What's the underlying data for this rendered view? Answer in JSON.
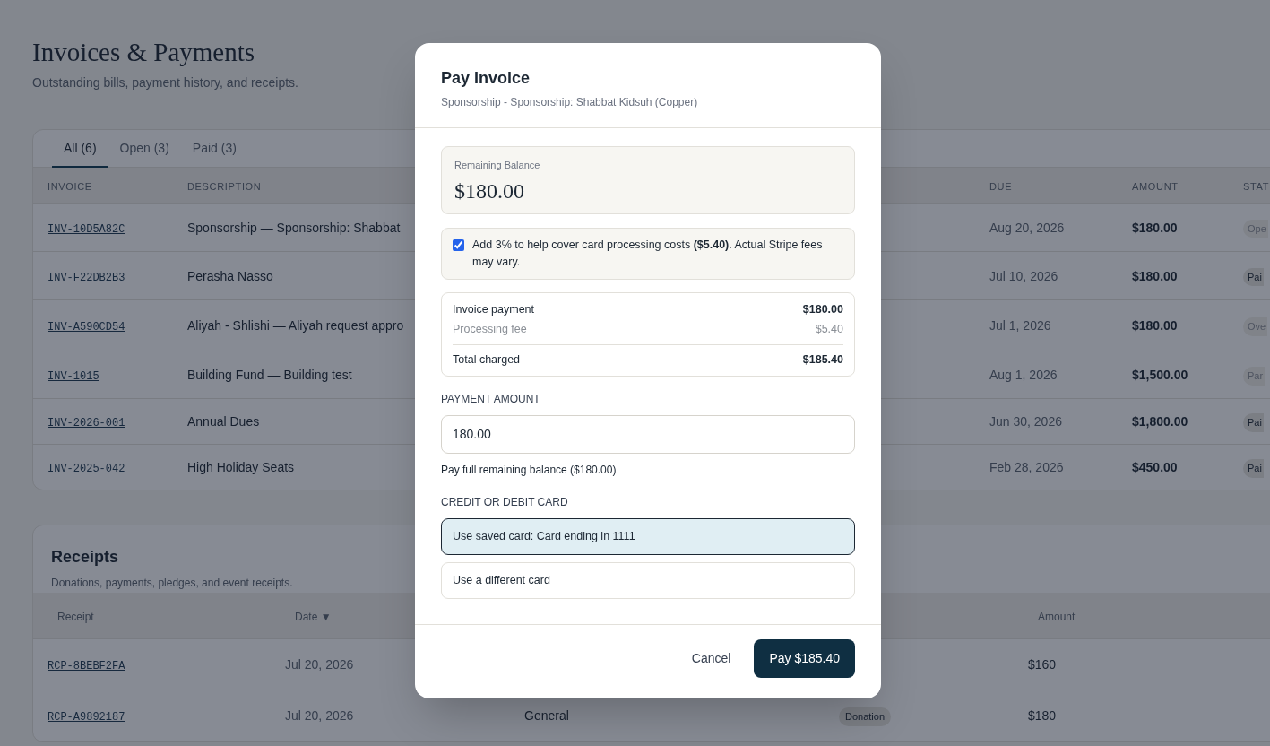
{
  "page": {
    "title": "Invoices & Payments",
    "subtitle": "Outstanding bills, payment history, and receipts."
  },
  "invoices": {
    "tabs": [
      {
        "label": "All (6)",
        "selected": true
      },
      {
        "label": "Open (3)",
        "selected": false
      },
      {
        "label": "Paid (3)",
        "selected": false
      }
    ],
    "columns": [
      "INVOICE",
      "DESCRIPTION",
      "DUE",
      "AMOUNT",
      "STAT"
    ],
    "rows": [
      {
        "invoice": "INV-10D5A82C",
        "description": "Sponsorship — Sponsorship: Shabbat",
        "due": "Aug 20, 2026",
        "amount": "$180.00",
        "status": {
          "label": "Ope",
          "kind": "faded"
        }
      },
      {
        "invoice": "INV-F22DB2B3",
        "description": "Perasha Nasso",
        "due": "Jul 10, 2026",
        "amount": "$180.00",
        "status": {
          "label": "Pai",
          "kind": "paid"
        }
      },
      {
        "invoice": "INV-A590CD54",
        "description": "Aliyah - Shlishi — Aliyah request appro",
        "due": "Jul 1, 2026",
        "amount": "$180.00",
        "status": {
          "label": "Ove",
          "kind": "faded"
        }
      },
      {
        "invoice": "INV-1015",
        "description": "Building Fund — Building test",
        "due": "Aug 1, 2026",
        "amount": "$1,500.00",
        "status": {
          "label": "Par",
          "kind": "faded"
        }
      },
      {
        "invoice": "INV-2026-001",
        "description": "Annual Dues",
        "due": "Jun 30, 2026",
        "amount": "$1,800.00",
        "status": {
          "label": "Pai",
          "kind": "paid"
        }
      },
      {
        "invoice": "INV-2025-042",
        "description": "High Holiday Seats",
        "due": "Feb 28, 2026",
        "amount": "$450.00",
        "status": {
          "label": "Pai",
          "kind": "paid"
        }
      }
    ]
  },
  "receipts": {
    "title": "Receipts",
    "subtitle": "Donations, payments, pledges, and event receipts.",
    "columns": [
      "Receipt",
      "Date ▼",
      null,
      null,
      "Amount"
    ],
    "rows": [
      {
        "receipt": "RCP-8BEBF2FA",
        "date": "Jul 20, 2026",
        "amount": "$160"
      },
      {
        "receipt": "RCP-A9892187",
        "date": "Jul 20, 2026",
        "category": "General",
        "type": "Donation",
        "amount": "$180"
      }
    ]
  },
  "modal": {
    "title": "Pay Invoice",
    "subtitle": "Sponsorship - Sponsorship: Shabbat Kidsuh (Copper)",
    "balance": {
      "label": "Remaining Balance",
      "value": "$180.00"
    },
    "fee_option": {
      "checked": true,
      "text": "Add 3% to help cover card processing costs **($5.40)**. Actual Stripe fees may vary."
    },
    "summary": [
      {
        "label": "Invoice payment",
        "value": "$180.00",
        "kind": "main"
      },
      {
        "label": "Processing fee",
        "value": "$5.40",
        "kind": "muted"
      },
      {
        "label": "Total charged",
        "value": "$185.40",
        "kind": "total"
      }
    ],
    "payment_amount": {
      "label": "PAYMENT AMOUNT",
      "value": "180.00",
      "hint": "Pay full remaining balance ($180.00)"
    },
    "card": {
      "label": "CREDIT OR DEBIT CARD",
      "options": [
        {
          "label": "Use saved card: Card ending in 1111",
          "selected": true
        },
        {
          "label": "Use a different card",
          "selected": false
        }
      ]
    },
    "buttons": {
      "cancel": "Cancel",
      "pay": "Pay $185.40"
    }
  }
}
